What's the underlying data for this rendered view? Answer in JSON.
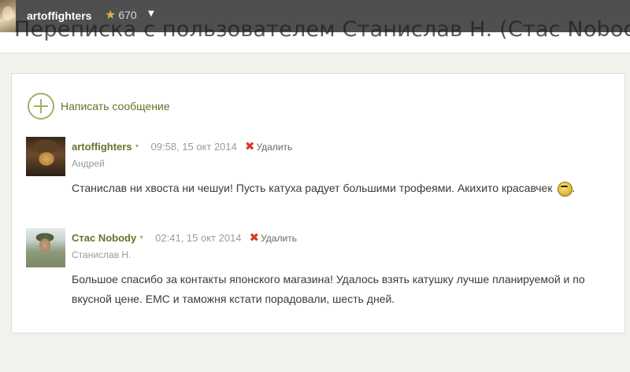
{
  "top_bar": {
    "username": "artoffighters",
    "rating": "670"
  },
  "page": {
    "title": "Переписка с пользователем Станислав Н. (Стас Nobody)"
  },
  "compose": {
    "label": "Написать сообщение"
  },
  "messages": [
    {
      "author": "artoffighters",
      "time": "09:58, 15 окт 2014",
      "delete_label": "Удалить",
      "real_name": "Андрей",
      "text": "Станислав ни хвоста ни чешуи! Пусть катуха радует большими трофеями. Акихито красавчек",
      "text_tail": "."
    },
    {
      "author": "Стас Nobody",
      "time": "02:41, 15 окт 2014",
      "delete_label": "Удалить",
      "real_name": "Станислав Н.",
      "text": "Большое спасибо за контакты японского магазина! Удалось взять катушку лучше планируемой и по вкусной цене. EMC и таможня кстати порадовали, шесть дней."
    }
  ],
  "colors": {
    "accent_green": "#62742a",
    "delete_red": "#d63a2c",
    "star": "#d9b043"
  },
  "icons": {
    "rating": "star-icon",
    "compose": "plus-circle-icon",
    "delete": "x-icon",
    "emoticon": "smiley-icon"
  }
}
